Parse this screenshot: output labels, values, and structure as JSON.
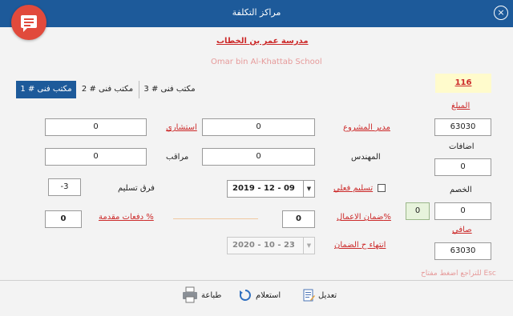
{
  "window": {
    "title": "مراكز التكلفة",
    "close_icon": "×"
  },
  "header": {
    "school_ar": "مدرسة عمر بن الخطاب",
    "school_en": "Omar bin Al-Khattab School"
  },
  "tabs": [
    "مكتب فنى # 1",
    "مكتب فنى # 2",
    "مكتب فنى # 3"
  ],
  "right_panel": {
    "code": "116",
    "amount_label": "المبلغ",
    "amount": "63030",
    "additions_label": "اضافات",
    "additions": "0",
    "discount_label": "الخصم",
    "discount": "0",
    "discount_flag": "0",
    "net_label": "صافي",
    "net": "63030"
  },
  "form": {
    "project_manager_label": "مدير المشروع",
    "project_manager": "0",
    "consultant_label": "استشاري",
    "consultant": "0",
    "engineer_label": "المهندس",
    "engineer": "0",
    "supervisor_label": "مراقب",
    "supervisor": "0",
    "actual_delivery_label": "تسليم فعلي",
    "actual_delivery_date": "2019 - 12 - 09",
    "delivery_diff_label": "فرق تسليم",
    "delivery_diff": "-3",
    "works_guarantee_label": "ضمان الاعمال%",
    "works_guarantee": "0",
    "advance_payments_label": "دفعات مقدمة %",
    "advance_payments": "0",
    "guarantee_end_label": "انتهاء ح الضمان",
    "guarantee_end_date": "2020 - 10 - 23"
  },
  "hint": "للتراجع اضغط مفتاح Esc",
  "toolbar": {
    "edit": "تعديل",
    "query": "استعلام",
    "print": "طباعة"
  },
  "colors": {
    "title_bar": "#1d5a9a",
    "accent_red": "#cc2a2a",
    "badge": "#e14a3c"
  }
}
